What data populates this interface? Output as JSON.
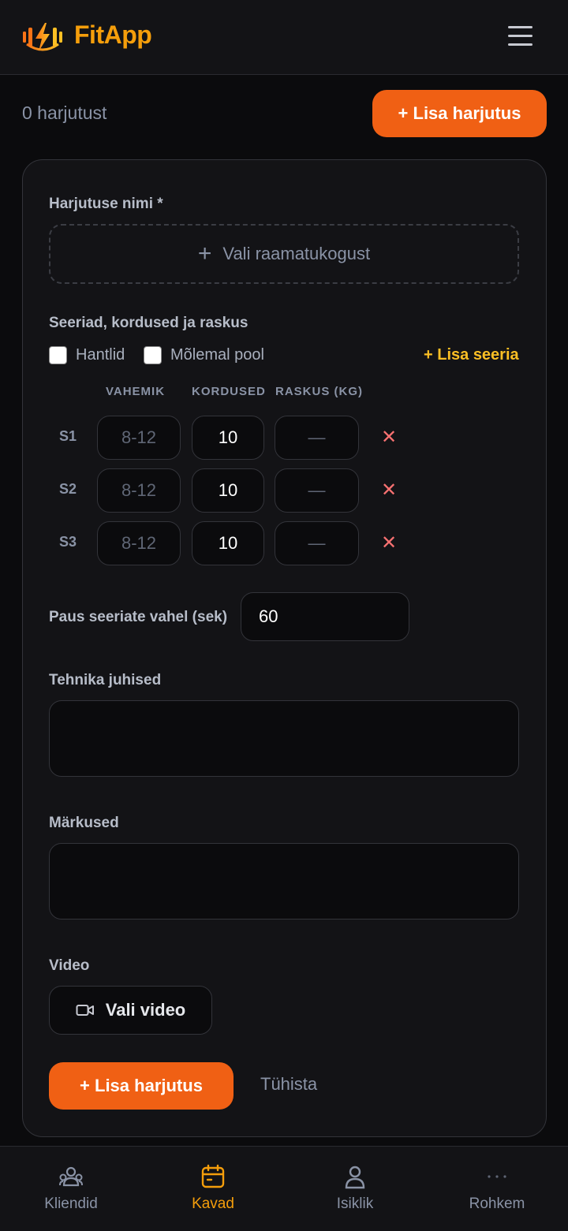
{
  "app": {
    "title": "FitApp"
  },
  "toolbar": {
    "count_text": "0 harjutust",
    "add_exercise_label": "+ Lisa harjutus"
  },
  "form": {
    "name_label": "Harjutuse nimi *",
    "pick_library_label": "Vali raamatukogust",
    "series_label": "Seeriad, kordused ja raskus",
    "dumbbells_label": "Hantlid",
    "both_sides_label": "Mõlemal pool",
    "add_series_label": "+ Lisa seeria",
    "columns": {
      "range": "VAHEMIK",
      "reps": "KORDUSED",
      "weight": "RASKUS (KG)"
    },
    "sets": [
      {
        "label": "S1",
        "range_placeholder": "8-12",
        "reps": "10",
        "weight_placeholder": "—"
      },
      {
        "label": "S2",
        "range_placeholder": "8-12",
        "reps": "10",
        "weight_placeholder": "—"
      },
      {
        "label": "S3",
        "range_placeholder": "8-12",
        "reps": "10",
        "weight_placeholder": "—"
      }
    ],
    "delete_symbol": "✕",
    "rest_label": "Paus seeriate vahel (sek)",
    "rest_value": "60",
    "technique_label": "Tehnika juhised",
    "notes_label": "Märkused",
    "video_label": "Video",
    "pick_video_label": "Vali video",
    "submit_label": "+ Lisa harjutus",
    "cancel_label": "Tühista"
  },
  "nav": {
    "items": [
      {
        "label": "Kliendid",
        "icon": "users-icon"
      },
      {
        "label": "Kavad",
        "icon": "calendar-icon"
      },
      {
        "label": "Isiklik",
        "icon": "user-icon"
      },
      {
        "label": "Rohkem",
        "icon": "more-icon"
      }
    ],
    "active": "Kavad"
  },
  "colors": {
    "accent": "#f06014",
    "brand": "#f59e0b",
    "danger": "#f87171"
  }
}
